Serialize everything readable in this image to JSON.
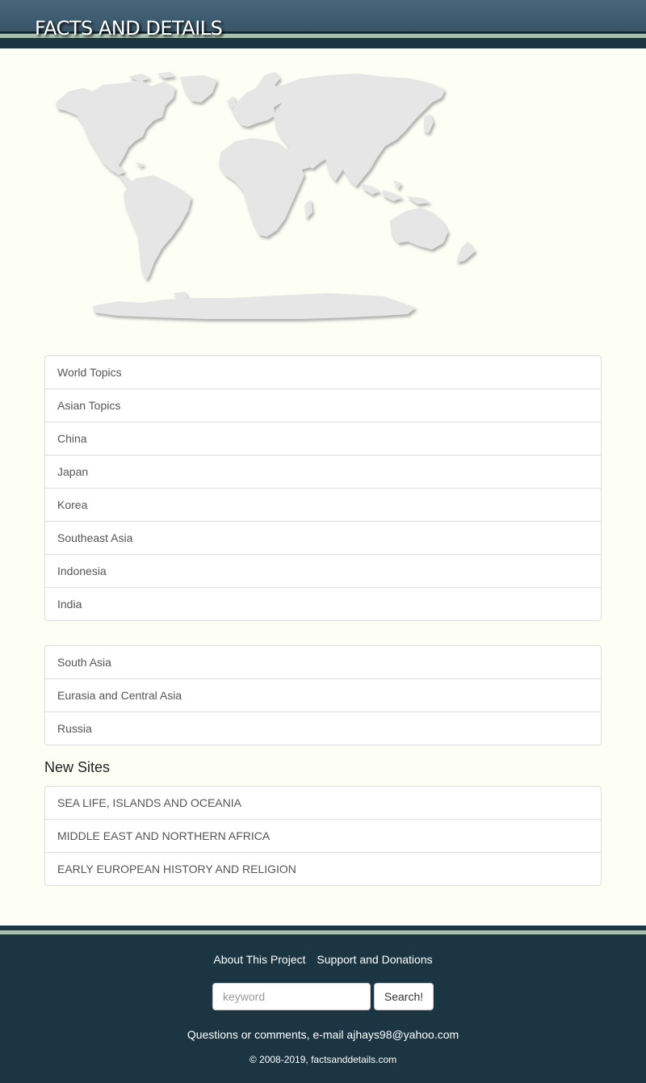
{
  "header": {
    "title": "FACTS AND DETAILS"
  },
  "map": {
    "icon": "world-map-icon",
    "fill_color": "#e4e4e4",
    "shadow_color": "#b8b8b8"
  },
  "primary_menu": {
    "items": [
      {
        "label": "World Topics"
      },
      {
        "label": "Asian Topics"
      },
      {
        "label": "China"
      },
      {
        "label": "Japan"
      },
      {
        "label": "Korea"
      },
      {
        "label": "Southeast Asia"
      },
      {
        "label": "Indonesia"
      },
      {
        "label": "India"
      }
    ]
  },
  "secondary_menu": {
    "items": [
      {
        "label": "South Asia"
      },
      {
        "label": "Eurasia and Central Asia"
      },
      {
        "label": "Russia"
      }
    ]
  },
  "new_sites": {
    "title": "New Sites",
    "items": [
      {
        "label": "SEA LIFE, ISLANDS AND OCEANIA"
      },
      {
        "label": "MIDDLE EAST AND NORTHERN AFRICA"
      },
      {
        "label": "EARLY EUROPEAN HISTORY AND RELIGION"
      }
    ]
  },
  "footer": {
    "about_label": "About This Project",
    "support_label": "Support and Donations",
    "search_placeholder": "keyword",
    "search_button": "Search!",
    "contact": "Questions or comments, e-mail ajhays98@yahoo.com",
    "copyright": "© 2008-2019, factsanddetails.com"
  },
  "colors": {
    "header_bg": "#3a5a6d",
    "footer_bg": "#1b3542",
    "page_bg": "#fdfff4",
    "stripe": "#a9c0b0"
  }
}
